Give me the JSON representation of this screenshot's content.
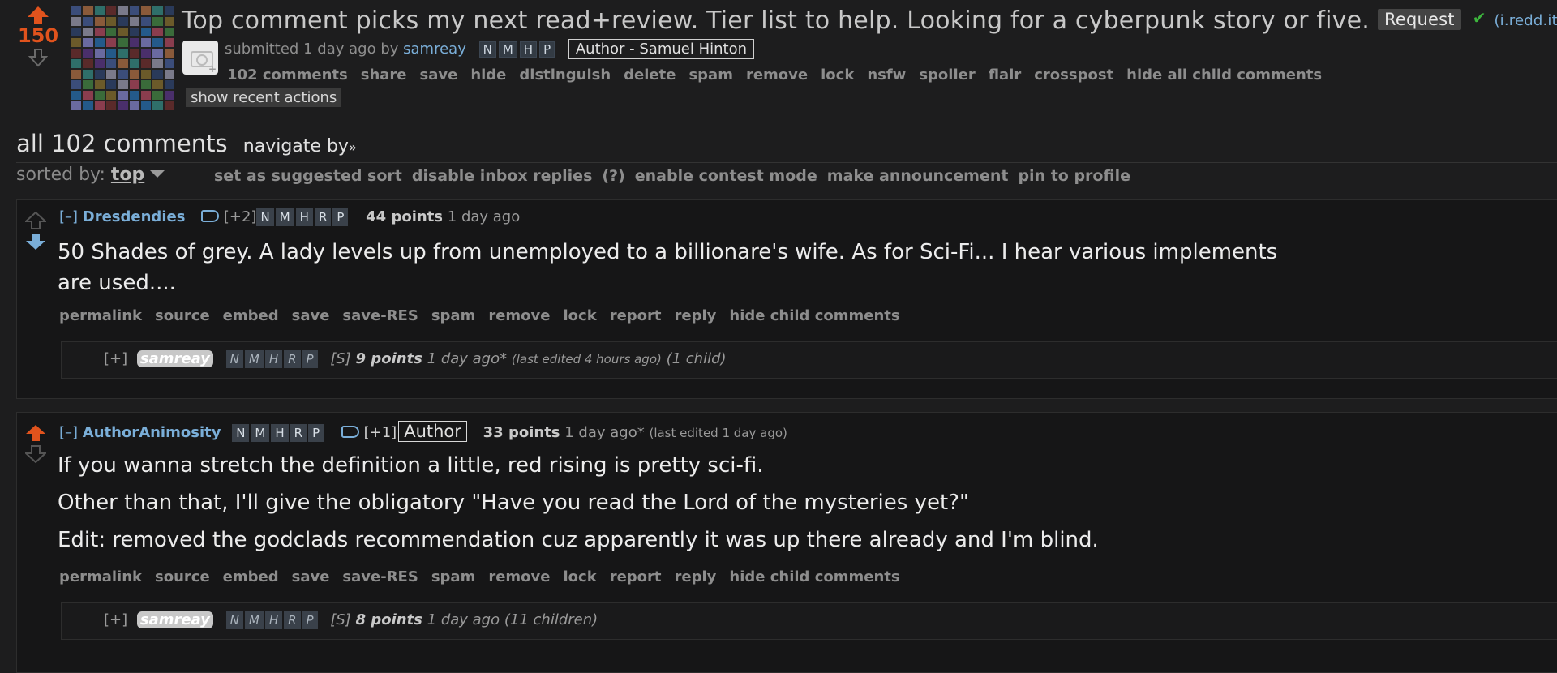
{
  "post": {
    "score": "150",
    "title": "Top comment picks my next read+review. Tier list to help. Looking for a cyberpunk story or five.",
    "link_flair": "Request",
    "domain": "(i.redd.it)",
    "submitted_prefix": "submitted",
    "submitted_time": "1 day ago",
    "submitted_by": "by",
    "author": "samreay",
    "author_tags": [
      "N",
      "M",
      "H",
      "P"
    ],
    "author_flair": "Author - Samuel Hinton",
    "links": [
      "102 comments",
      "share",
      "save",
      "hide",
      "distinguish",
      "delete",
      "spam",
      "remove",
      "lock",
      "nsfw",
      "spoiler",
      "flair",
      "crosspost",
      "hide all child comments"
    ],
    "recent_actions": "show recent actions"
  },
  "comments_header": {
    "title": "all 102 comments",
    "navigate": "navigate by",
    "sorted_label": "sorted by:",
    "sort_value": "top",
    "sort_links": [
      "set as suggested sort",
      "disable inbox replies",
      "(?)",
      "enable contest mode",
      "make announcement",
      "pin to profile"
    ]
  },
  "comments": [
    {
      "expander": "[–]",
      "user": "Dresdendies",
      "vote_change": "[+2]",
      "tags": [
        "N",
        "M",
        "H",
        "R",
        "P"
      ],
      "points": "44 points",
      "time": "1 day ago",
      "body": [
        "50 Shades of grey. A lady levels up from unemployed to a billionare's wife. As for Sci-Fi... I hear various implements",
        "are used...."
      ],
      "links": [
        "permalink",
        "source",
        "embed",
        "save",
        "save-RES",
        "spam",
        "remove",
        "lock",
        "report",
        "reply",
        "hide child comments"
      ],
      "child": {
        "expander": "[+]",
        "user": "samreay",
        "tags": [
          "N",
          "M",
          "H",
          "R",
          "P"
        ],
        "s_tag": "[S]",
        "points": "9 points",
        "time": "1 day ago*",
        "edited": "(last edited 4 hours ago)",
        "children": "(1 child)"
      }
    },
    {
      "expander": "[–]",
      "user": "AuthorAnimosity",
      "tags": [
        "N",
        "M",
        "H",
        "R",
        "P"
      ],
      "vote_change": "[+1]",
      "flair": "Author",
      "points": "33 points",
      "time": "1 day ago*",
      "edited": "(last edited 1 day ago)",
      "body": [
        "If you wanna stretch the definition a little, red rising is pretty sci-fi.",
        "Other than that, I'll give the obligatory \"Have you read the Lord of the mysteries yet?\"",
        "Edit: removed the godclads recommendation cuz apparently it was up there already and I'm blind."
      ],
      "links": [
        "permalink",
        "source",
        "embed",
        "save",
        "save-RES",
        "spam",
        "remove",
        "lock",
        "report",
        "reply",
        "hide child comments"
      ],
      "child": {
        "expander": "[+]",
        "user": "samreay",
        "tags": [
          "N",
          "M",
          "H",
          "R",
          "P"
        ],
        "s_tag": "[S]",
        "points": "8 points",
        "time": "1 day ago",
        "children": "(11 children)"
      }
    }
  ],
  "colors": {
    "upvote": "#e1531d",
    "link": "#7aaed8",
    "background": "#1d1d1e",
    "downvoted": "#7aaed8"
  }
}
